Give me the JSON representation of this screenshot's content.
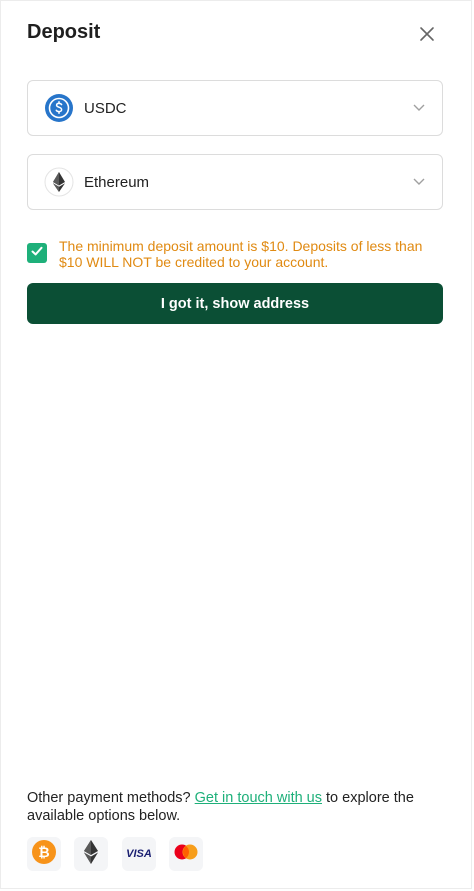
{
  "modal": {
    "title": "Deposit",
    "close_icon": "close-icon"
  },
  "currency_select": {
    "value": "USDC",
    "icon": "usdc-icon"
  },
  "network_select": {
    "value": "Ethereum",
    "icon": "ethereum-icon"
  },
  "notice": {
    "checked": true,
    "text": "The minimum deposit amount is $10. Deposits of less than $10 WILL NOT be credited to your account."
  },
  "cta": {
    "label": "I got it, show address"
  },
  "footer": {
    "text_before": "Other payment methods? ",
    "link": "Get in touch with us",
    "text_after": " to explore the available options below.",
    "methods": [
      "bitcoin-icon",
      "ethereum-icon",
      "visa-icon",
      "mastercard-icon"
    ],
    "visa_text": "VISA"
  },
  "colors": {
    "accent": "#1eb07a",
    "primary_button": "#0b4f35",
    "warning": "#e08a12",
    "usdc": "#2775ca",
    "bitcoin": "#f7931a"
  }
}
